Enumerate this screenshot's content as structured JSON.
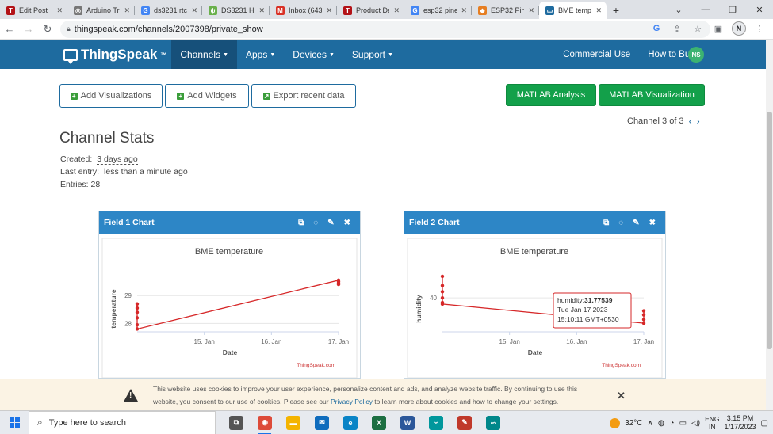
{
  "browser": {
    "tabs": [
      {
        "label": "Edit Post",
        "icon": "blogger-icon",
        "color": "#b31217",
        "glyph": "T"
      },
      {
        "label": "Arduino Tr",
        "icon": "web-icon",
        "color": "#777777",
        "glyph": "◎"
      },
      {
        "label": "ds3231 rtc",
        "icon": "google-icon",
        "color": "#4285f4",
        "glyph": "G"
      },
      {
        "label": "DS3231 Hi",
        "icon": "leaf-icon",
        "color": "#6ab04c",
        "glyph": "ψ"
      },
      {
        "label": "Inbox (643",
        "icon": "gmail-icon",
        "color": "#d93025",
        "glyph": "M"
      },
      {
        "label": "Product De",
        "icon": "blogger-icon",
        "color": "#b31217",
        "glyph": "T"
      },
      {
        "label": "esp32 pine",
        "icon": "google-icon",
        "color": "#4285f4",
        "glyph": "G"
      },
      {
        "label": "ESP32 Pin",
        "icon": "chip-icon",
        "color": "#e67e22",
        "glyph": "◆"
      },
      {
        "label": "BME temp",
        "icon": "page-icon",
        "color": "#1e6b9f",
        "glyph": "▭",
        "active": true
      }
    ],
    "url": "thingspeak.com/channels/2007398/private_show",
    "profile_initial": "N"
  },
  "navbar": {
    "brand": "ThingSpeak",
    "brand_tm": "™",
    "menu": [
      {
        "label": "Channels",
        "active": true
      },
      {
        "label": "Apps"
      },
      {
        "label": "Devices"
      },
      {
        "label": "Support"
      }
    ],
    "right_links": [
      "Commercial Use",
      "How to Buy"
    ],
    "user_initials": "NS"
  },
  "toolbar": {
    "add_visualizations": "Add Visualizations",
    "add_widgets": "Add Widgets",
    "export_data": "Export recent data",
    "matlab_analysis": "MATLAB Analysis",
    "matlab_visualization": "MATLAB Visualization"
  },
  "channel_nav": {
    "label": "Channel 3 of 3"
  },
  "stats": {
    "title": "Channel Stats",
    "created_label": "Created:",
    "created_value": "3 days ago",
    "last_entry_label": "Last entry:",
    "last_entry_value": "less than a minute ago",
    "entries_label": "Entries:",
    "entries_value": "28"
  },
  "widgets": [
    {
      "title": "Field 1 Chart",
      "chart_data": {
        "type": "line",
        "title": "BME temperature",
        "xlabel": "Date",
        "ylabel": "temperature",
        "x_ticks": [
          "15. Jan",
          "16. Jan",
          "17. Jan"
        ],
        "y_ticks": [
          28,
          29
        ],
        "ylim": [
          27.7,
          29.8
        ],
        "series": [
          {
            "color": "#d62728",
            "points": [
              [
                "14. Jan",
                28.7
              ],
              [
                "14. Jan",
                28.55
              ],
              [
                "14. Jan",
                28.4
              ],
              [
                "14. Jan",
                28.2
              ],
              [
                "14. Jan",
                27.95
              ],
              [
                "14. Jan",
                27.8
              ],
              [
                "17. Jan",
                29.55
              ],
              [
                "17. Jan",
                29.5
              ],
              [
                "17. Jan",
                29.45
              ],
              [
                "17. Jan",
                29.4
              ]
            ]
          }
        ],
        "credit": "ThingSpeak.com"
      }
    },
    {
      "title": "Field 2 Chart",
      "chart_data": {
        "type": "line",
        "title": "BME temperature",
        "xlabel": "Date",
        "ylabel": "humidity",
        "x_ticks": [
          "15. Jan",
          "16. Jan",
          "17. Jan"
        ],
        "y_ticks": [
          40
        ],
        "ylim": [
          29,
          48
        ],
        "series": [
          {
            "color": "#d62728",
            "points": [
              [
                "14. Jan",
                47
              ],
              [
                "14. Jan",
                44
              ],
              [
                "14. Jan",
                42
              ],
              [
                "14. Jan",
                40
              ],
              [
                "14. Jan",
                38.5
              ],
              [
                "14. Jan",
                38
              ],
              [
                "17. Jan",
                31.8
              ],
              [
                "17. Jan",
                33
              ],
              [
                "17. Jan",
                34.5
              ],
              [
                "17. Jan",
                35.8
              ]
            ]
          }
        ],
        "tooltip": {
          "label": "humidity:",
          "value": "31.77539",
          "line2": "Tue Jan 17 2023",
          "line3": "15:10:11 GMT+0530"
        },
        "credit": "ThingSpeak.com"
      }
    }
  ],
  "cookie": {
    "line1": "This website uses cookies to improve your user experience, personalize content and ads, and analyze website traffic. By continuing to use this",
    "line2a": "website, you consent to our use of cookies. Please see our ",
    "link": "Privacy Policy",
    "line2b": " to learn more about cookies and how to change your settings."
  },
  "taskbar": {
    "search_placeholder": "Type here to search",
    "apps": [
      {
        "name": "task-view-icon",
        "color": "#555555",
        "glyph": "⧉"
      },
      {
        "name": "chrome-icon",
        "color": "#dd4b39",
        "glyph": "◉",
        "active": true
      },
      {
        "name": "file-explorer-icon",
        "color": "#f4b400",
        "glyph": "▬"
      },
      {
        "name": "mail-icon",
        "color": "#0f6cbd",
        "glyph": "✉"
      },
      {
        "name": "edge-icon",
        "color": "#0a84c6",
        "glyph": "e"
      },
      {
        "name": "excel-icon",
        "color": "#1d6f42",
        "glyph": "X"
      },
      {
        "name": "word-icon",
        "color": "#2b579a",
        "glyph": "W"
      },
      {
        "name": "arduino-icon",
        "color": "#00979c",
        "glyph": "∞"
      },
      {
        "name": "paint-icon",
        "color": "#c0392b",
        "glyph": "✎"
      },
      {
        "name": "arduino-ide-icon",
        "color": "#00878a",
        "glyph": "∞"
      }
    ],
    "temperature": "32°C",
    "lang_top": "ENG",
    "lang_bottom": "IN",
    "time": "3:15 PM",
    "date": "1/17/2023"
  }
}
